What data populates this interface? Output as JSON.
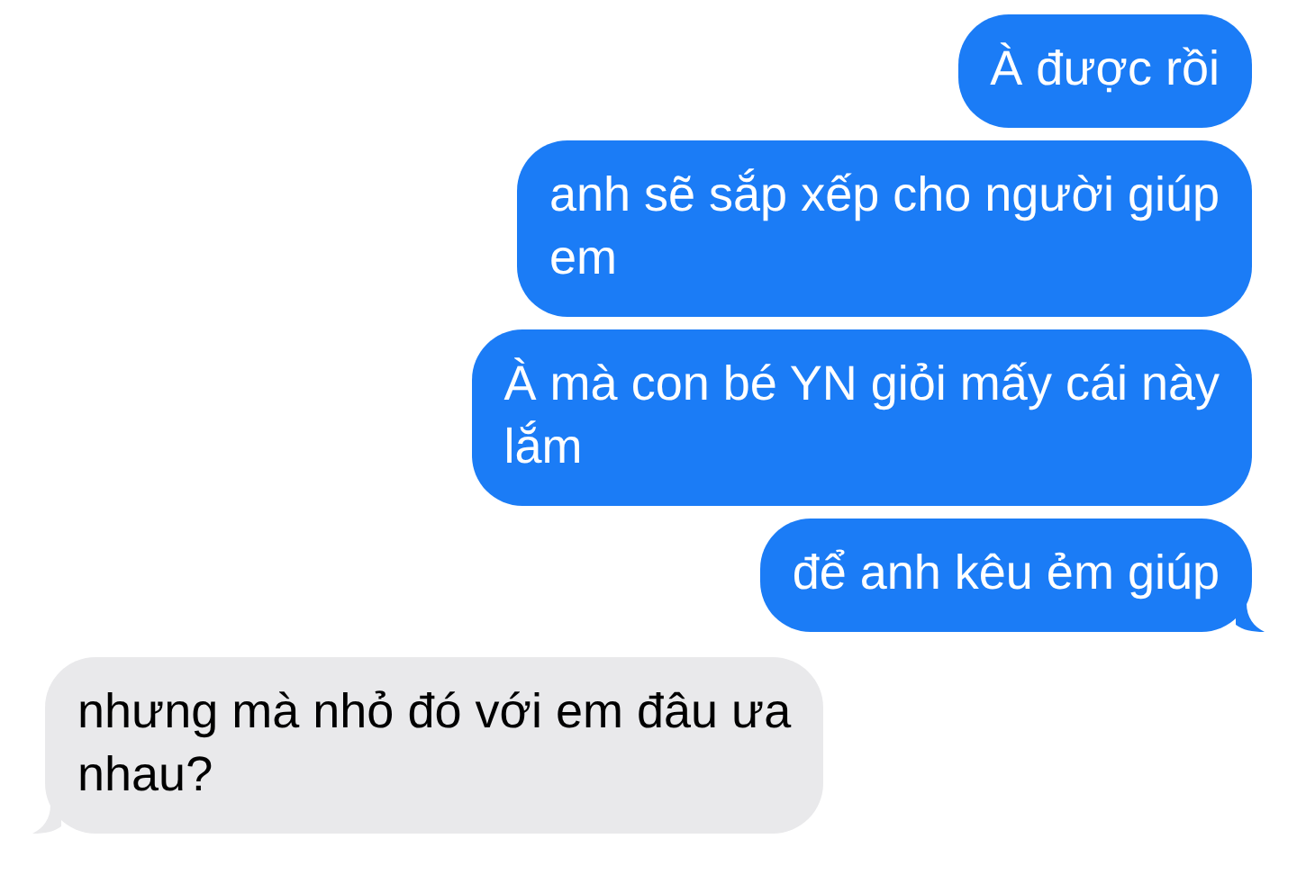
{
  "messages": [
    {
      "kind": "outgoing",
      "lines": [
        "À được rồi"
      ],
      "tail": false
    },
    {
      "kind": "outgoing",
      "lines": [
        "anh sẽ sắp xếp cho người giúp",
        "em"
      ],
      "tail": false
    },
    {
      "kind": "outgoing",
      "lines": [
        "À mà con bé YN giỏi mấy cái này",
        "lắm"
      ],
      "tail": false
    },
    {
      "kind": "outgoing",
      "lines": [
        "để anh kêu ẻm giúp"
      ],
      "tail": true
    },
    {
      "kind": "incoming",
      "lines": [
        "nhưng mà nhỏ đó với em đâu ưa",
        "nhau?"
      ],
      "tail": true
    }
  ]
}
